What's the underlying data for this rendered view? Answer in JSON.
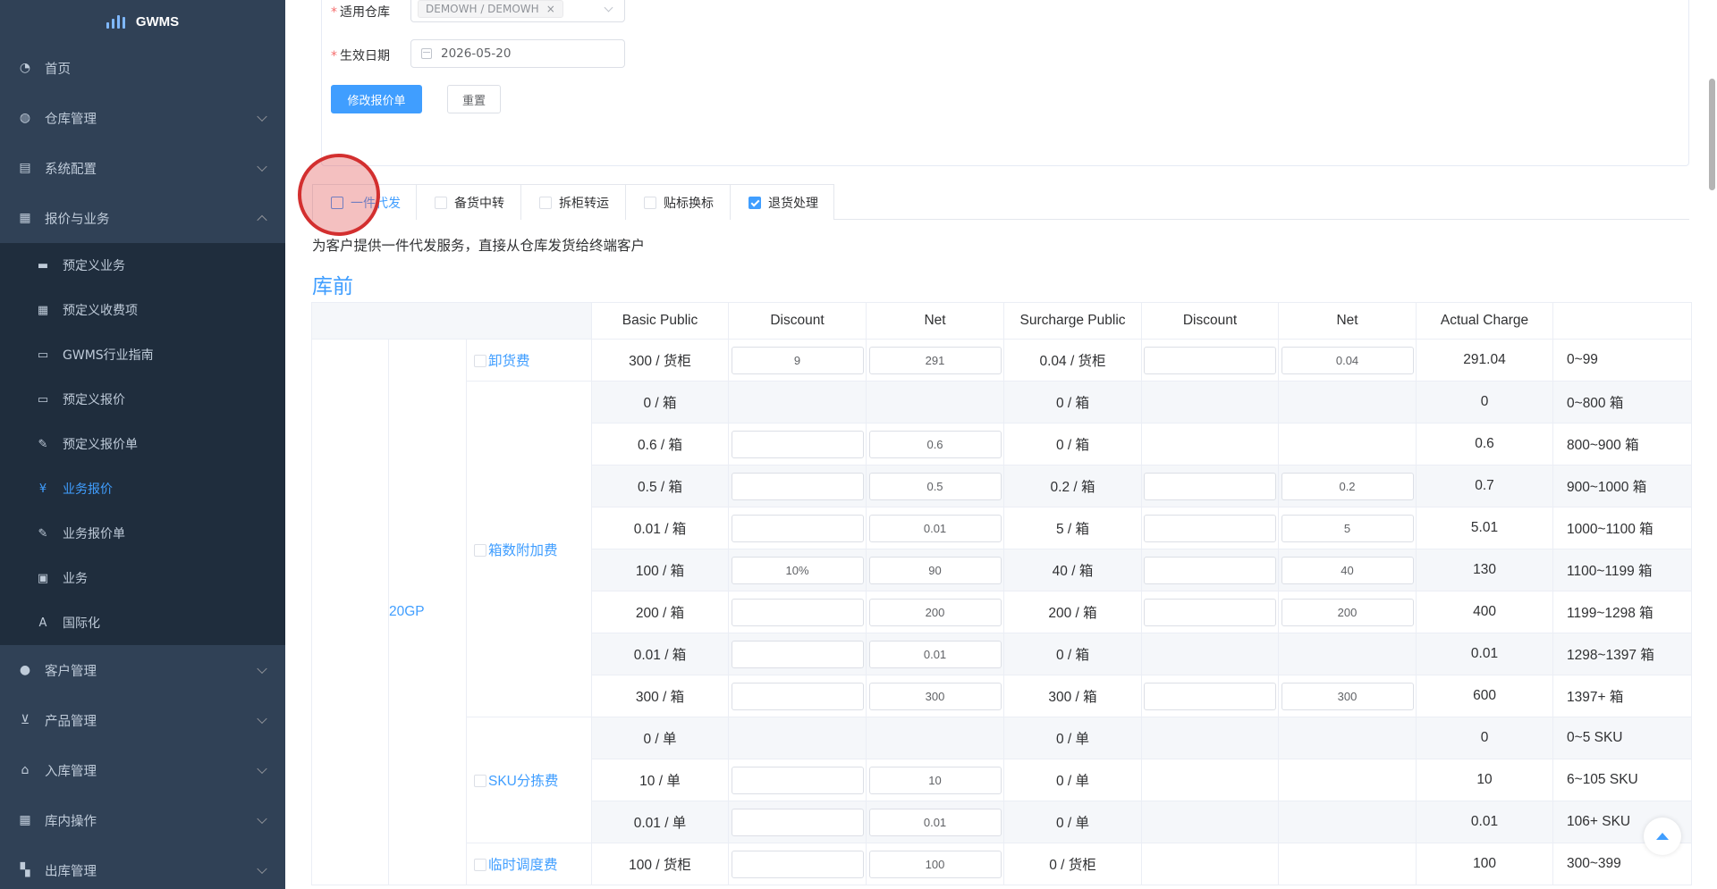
{
  "app": {
    "title": "GWMS"
  },
  "sidebar": {
    "items": [
      {
        "label": "首页",
        "icon": "dashboard-icon",
        "expandable": false
      },
      {
        "label": "仓库管理",
        "icon": "globe-icon",
        "expandable": true
      },
      {
        "label": "系统配置",
        "icon": "server-icon",
        "expandable": true
      },
      {
        "label": "报价与业务",
        "icon": "quote-icon",
        "expandable": true,
        "open": true
      }
    ],
    "submenu": [
      {
        "label": "预定义业务",
        "icon": "folder-icon"
      },
      {
        "label": "预定义收费项",
        "icon": "table-icon"
      },
      {
        "label": "GWMS行业指南",
        "icon": "doc-icon"
      },
      {
        "label": "预定义报价",
        "icon": "doc-icon"
      },
      {
        "label": "预定义报价单",
        "icon": "edit-icon"
      },
      {
        "label": "业务报价",
        "icon": "yen-icon",
        "active": true
      },
      {
        "label": "业务报价单",
        "icon": "edit-icon"
      },
      {
        "label": "业务",
        "icon": "briefcase-icon"
      },
      {
        "label": "国际化",
        "icon": "language-icon"
      }
    ],
    "items_after": [
      {
        "label": "客户管理",
        "icon": "user-icon"
      },
      {
        "label": "产品管理",
        "icon": "cart-icon"
      },
      {
        "label": "入库管理",
        "icon": "home-icon"
      },
      {
        "label": "库内操作",
        "icon": "grid-icon"
      },
      {
        "label": "出库管理",
        "icon": "apps-icon"
      }
    ]
  },
  "form": {
    "warehouse_label": "适用仓库",
    "warehouse_tag": "DEMOWH / DEMOWH",
    "date_label": "生效日期",
    "date_value": "2026-05-20",
    "submit_label": "修改报价单",
    "reset_label": "重置"
  },
  "tabs": [
    {
      "label": "一件代发",
      "checked": false,
      "active": true
    },
    {
      "label": "备货中转",
      "checked": false
    },
    {
      "label": "拆柜转运",
      "checked": false
    },
    {
      "label": "贴标换标",
      "checked": false
    },
    {
      "label": "退货处理",
      "checked": true
    }
  ],
  "description": "为客户提供一件代发服务，直接从仓库发货给终端客户",
  "section_title": "库前",
  "table": {
    "headers": [
      "Basic Public",
      "Discount",
      "Net",
      "Surcharge Public",
      "Discount",
      "Net",
      "Actual Charge"
    ],
    "container": "20GP",
    "groups": [
      {
        "name": "卸货费",
        "rows": [
          {
            "basic": "300 / 货柜",
            "disc": "9",
            "net": "291",
            "sur": "0.04 / 货柜",
            "sdisc": "",
            "snet": "0.04",
            "actual": "291.04",
            "range": "0~99",
            "editable": true
          }
        ]
      },
      {
        "name": "箱数附加费",
        "rows": [
          {
            "basic": "0 / 箱",
            "disc": null,
            "net": null,
            "sur": "0 / 箱",
            "sdisc": null,
            "snet": null,
            "actual": "0",
            "range": "0~800 箱"
          },
          {
            "basic": "0.6 / 箱",
            "disc": "",
            "net": "0.6",
            "sur": "0 / 箱",
            "sdisc": null,
            "snet": null,
            "actual": "0.6",
            "range": "800~900 箱"
          },
          {
            "basic": "0.5 / 箱",
            "disc": "",
            "net": "0.5",
            "sur": "0.2 / 箱",
            "sdisc": "",
            "snet": "0.2",
            "actual": "0.7",
            "range": "900~1000 箱"
          },
          {
            "basic": "0.01 / 箱",
            "disc": "",
            "net": "0.01",
            "sur": "5 / 箱",
            "sdisc": "",
            "snet": "5",
            "actual": "5.01",
            "range": "1000~1100 箱"
          },
          {
            "basic": "100 / 箱",
            "disc": "10%",
            "net": "90",
            "sur": "40 / 箱",
            "sdisc": "",
            "snet": "40",
            "actual": "130",
            "range": "1100~1199 箱"
          },
          {
            "basic": "200 / 箱",
            "disc": "",
            "net": "200",
            "sur": "200 / 箱",
            "sdisc": "",
            "snet": "200",
            "actual": "400",
            "range": "1199~1298 箱"
          },
          {
            "basic": "0.01 / 箱",
            "disc": "",
            "net": "0.01",
            "sur": "0 / 箱",
            "sdisc": null,
            "snet": null,
            "actual": "0.01",
            "range": "1298~1397 箱"
          },
          {
            "basic": "300 / 箱",
            "disc": "",
            "net": "300",
            "sur": "300 / 箱",
            "sdisc": "",
            "snet": "300",
            "actual": "600",
            "range": "1397+ 箱"
          }
        ]
      },
      {
        "name": "SKU分拣费",
        "rows": [
          {
            "basic": "0 / 单",
            "disc": null,
            "net": null,
            "sur": "0 / 单",
            "sdisc": null,
            "snet": null,
            "actual": "0",
            "range": "0~5 SKU"
          },
          {
            "basic": "10 / 单",
            "disc": "",
            "net": "10",
            "sur": "0 / 单",
            "sdisc": null,
            "snet": null,
            "actual": "10",
            "range": "6~105 SKU"
          },
          {
            "basic": "0.01 / 单",
            "disc": "",
            "net": "0.01",
            "sur": "0 / 单",
            "sdisc": null,
            "snet": null,
            "actual": "0.01",
            "range": "106+ SKU"
          }
        ]
      },
      {
        "name": "临时调度费",
        "rows": [
          {
            "basic": "100 / 货柜",
            "disc": "",
            "net": "100",
            "sur": "0 / 货柜",
            "sdisc": null,
            "snet": null,
            "actual": "100",
            "range": "300~399"
          }
        ]
      }
    ]
  },
  "colors": {
    "sidebar_bg": "#304156",
    "submenu_bg": "#1f2d3d",
    "accent": "#409eff",
    "sidebar_text": "#bfcbd9"
  }
}
